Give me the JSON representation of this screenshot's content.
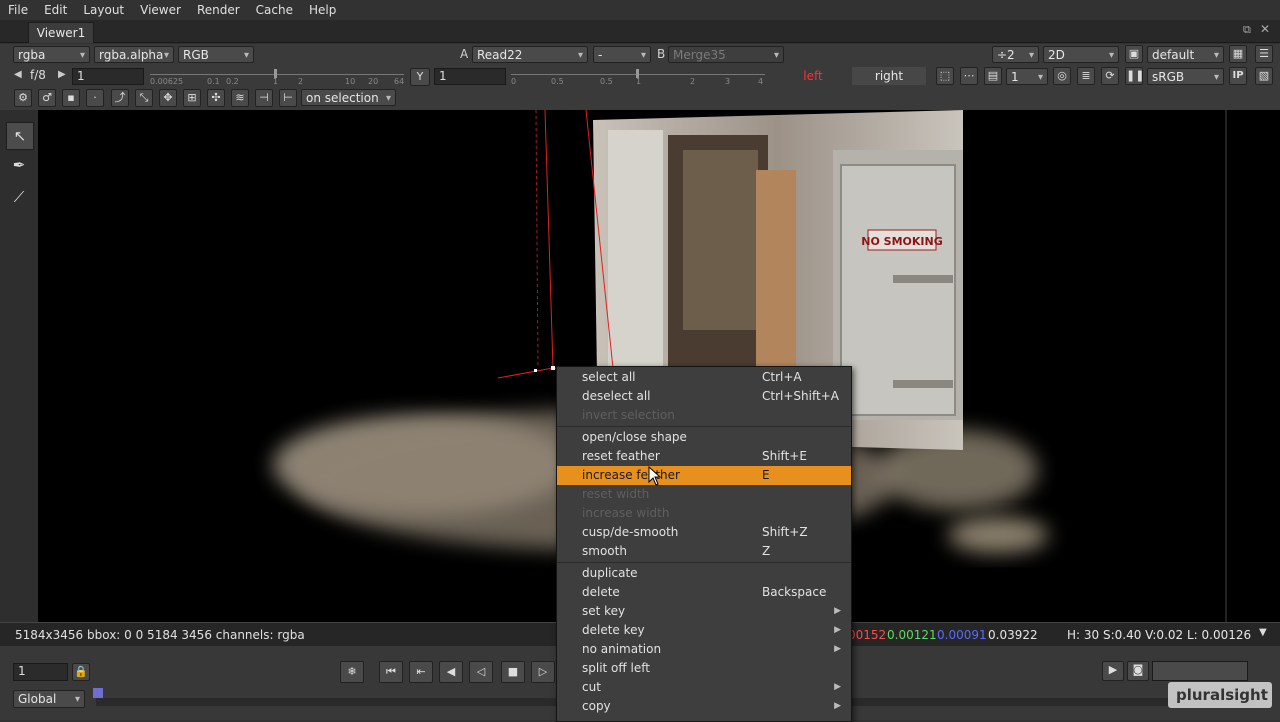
{
  "menubar": [
    "File",
    "Edit",
    "Layout",
    "Viewer",
    "Render",
    "Cache",
    "Help"
  ],
  "tab": {
    "title": "Viewer1"
  },
  "row1": {
    "channels": "rgba",
    "alpha": "rgba.alpha",
    "colorspace": "RGB",
    "a_label": "A",
    "a_input": "Read22",
    "op": "-",
    "b_label": "B",
    "b_input": "Merge35",
    "downrez": "÷2",
    "view_mode": "2D",
    "lut": "default"
  },
  "row2": {
    "fstop": "f/8",
    "gain": "1",
    "gain_ticks": [
      "0.00625",
      "0.1",
      "0.2",
      "1",
      "2",
      "10",
      "20",
      "64"
    ],
    "y_label": "Y",
    "gamma": "1",
    "gamma_ticks": [
      "0",
      "0.5",
      "0.5",
      "1",
      "2",
      "3",
      "4"
    ],
    "left_label": "left",
    "right_label": "right",
    "proxy": "1",
    "display": "sRGB",
    "ip": "IP"
  },
  "row3": {
    "selection_mode": "on selection"
  },
  "status": {
    "info": "5184x3456 bbox: 0 0 5184 3456 channels: rgba",
    "r": "00152",
    "g": "0.00121",
    "b": "0.00091",
    "a": "0.03922",
    "hsv": "H: 30 S:0.40 V:0.02  L: 0.00126"
  },
  "timeline": {
    "frame": "1",
    "scope": "Global",
    "watermark": "pluralsight"
  },
  "photo": {
    "sign": "NO SMOKING"
  },
  "context_menu": [
    {
      "label": "select all",
      "shortcut": "Ctrl+A",
      "state": "normal"
    },
    {
      "label": "deselect all",
      "shortcut": "Ctrl+Shift+A",
      "state": "normal"
    },
    {
      "label": "invert selection",
      "shortcut": "",
      "state": "disabled"
    },
    {
      "label": "open/close shape",
      "shortcut": "",
      "state": "normal",
      "sep_before": true
    },
    {
      "label": "reset feather",
      "shortcut": "Shift+E",
      "state": "normal"
    },
    {
      "label": "increase feather",
      "shortcut": "E",
      "state": "highlighted"
    },
    {
      "label": "reset width",
      "shortcut": "",
      "state": "disabled"
    },
    {
      "label": "increase width",
      "shortcut": "",
      "state": "disabled"
    },
    {
      "label": "cusp/de-smooth",
      "shortcut": "Shift+Z",
      "state": "normal"
    },
    {
      "label": "smooth",
      "shortcut": "Z",
      "state": "normal"
    },
    {
      "label": "duplicate",
      "shortcut": "",
      "state": "normal",
      "sep_before": true
    },
    {
      "label": "delete",
      "shortcut": "Backspace",
      "state": "normal"
    },
    {
      "label": "set key",
      "shortcut": "",
      "state": "normal",
      "submenu": true
    },
    {
      "label": "delete key",
      "shortcut": "",
      "state": "normal",
      "submenu": true
    },
    {
      "label": "no animation",
      "shortcut": "",
      "state": "normal",
      "submenu": true
    },
    {
      "label": "split off left",
      "shortcut": "",
      "state": "normal"
    },
    {
      "label": "cut",
      "shortcut": "",
      "state": "normal",
      "submenu": true
    },
    {
      "label": "copy",
      "shortcut": "",
      "state": "normal",
      "submenu": true
    }
  ],
  "colors": {
    "highlight": "#e8901e",
    "accent_red": "#ff3030"
  }
}
